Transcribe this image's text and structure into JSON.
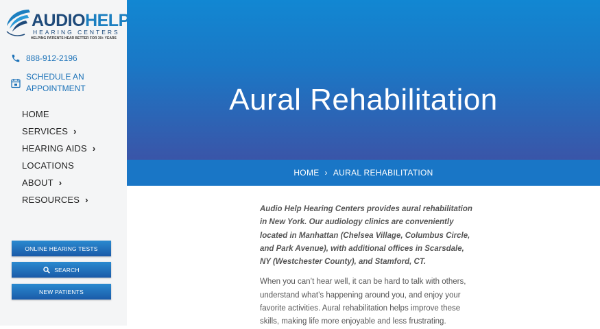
{
  "logo": {
    "audio": "AUDIO",
    "help": "HELP",
    "subtitle": "HEARING CENTERS",
    "tagline": "HELPING PATIENTS HEAR BETTER FOR 30+ YEARS"
  },
  "contact": {
    "phone": "888-912-2196",
    "appointment": "SCHEDULE AN APPOINTMENT"
  },
  "nav": [
    {
      "label": "HOME",
      "has_submenu": false
    },
    {
      "label": "SERVICES",
      "has_submenu": true
    },
    {
      "label": "HEARING AIDS",
      "has_submenu": true
    },
    {
      "label": "LOCATIONS",
      "has_submenu": false
    },
    {
      "label": "ABOUT",
      "has_submenu": true
    },
    {
      "label": "RESOURCES",
      "has_submenu": true
    }
  ],
  "buttons": {
    "online_tests": "ONLINE HEARING TESTS",
    "search": "SEARCH",
    "new_patients": "NEW PATIENTS"
  },
  "hero": {
    "title": "Aural Rehabilitation"
  },
  "breadcrumb": {
    "home": "HOME",
    "current": "AURAL REHABILITATION"
  },
  "content": {
    "intro": "Audio Help Hearing Centers provides aural rehabilitation in New York. Our audiology clinics are conveniently located in Manhattan (Chelsea Village, Columbus Circle, and Park Avenue), with additional offices in Scarsdale, NY (Westchester County), and Stamford, CT.",
    "paragraph": "When you can’t hear well, it can be hard to talk with others, understand what’s happening around you, and enjoy your favorite activities. Aural rehabilitation helps improve these skills, making life more enjoyable and less frustrating."
  },
  "colors": {
    "accent": "#1c72b8",
    "hero_top": "#1287d2",
    "hero_bottom": "#3a55a8",
    "breadcrumb_bar": "#1976c6"
  },
  "icons": {
    "phone": "phone-icon",
    "calendar": "calendar-icon",
    "chevron": "chevron-right-icon",
    "search": "search-icon"
  }
}
